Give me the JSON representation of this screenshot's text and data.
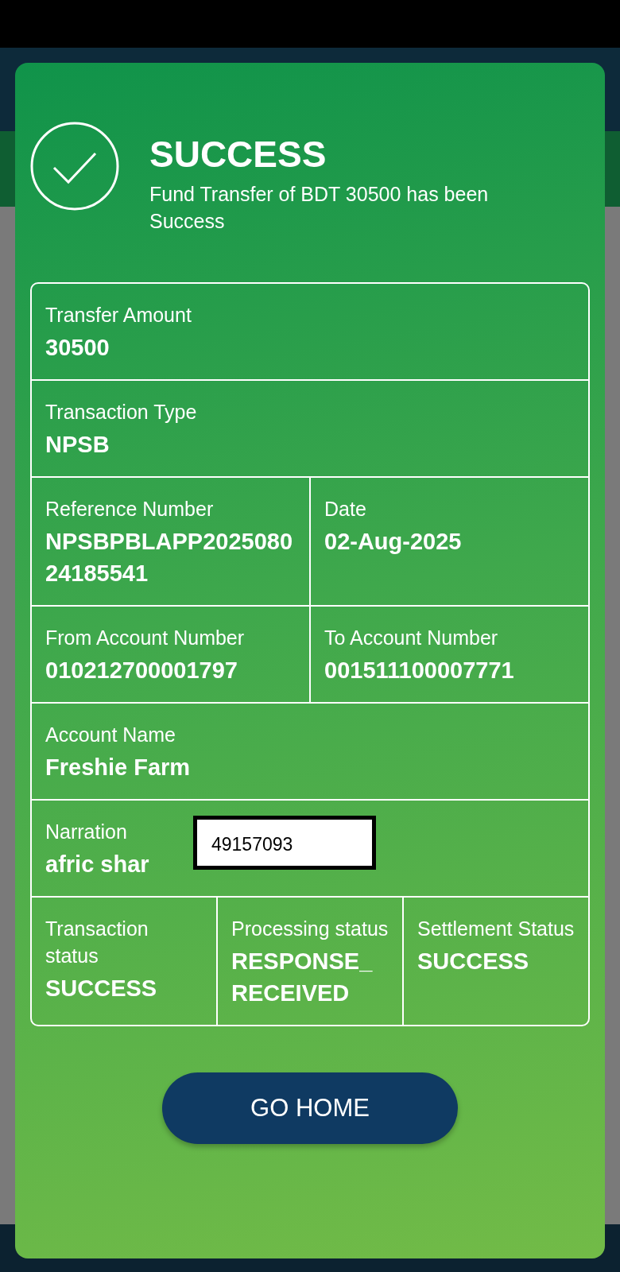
{
  "dialog": {
    "title": "SUCCESS",
    "message": "Fund Transfer of BDT 30500 has been Success"
  },
  "details": [
    {
      "cells": [
        {
          "label": "Transfer Amount",
          "value": "30500"
        }
      ]
    },
    {
      "cells": [
        {
          "label": "Transaction Type",
          "value": "NPSB"
        }
      ]
    },
    {
      "cells": [
        {
          "label": "Reference Number",
          "value": "NPSBPBLAPP202508024185541"
        },
        {
          "label": "Date",
          "value": "02-Aug-2025"
        }
      ]
    },
    {
      "cells": [
        {
          "label": "From Account Number",
          "value": "010212700001797"
        },
        {
          "label": "To Account Number",
          "value": "001511100007771"
        }
      ]
    },
    {
      "cells": [
        {
          "label": "Account Name",
          "value": "Freshie Farm"
        }
      ]
    },
    {
      "cells": [
        {
          "label": "Narration",
          "value": "afric shar"
        }
      ],
      "note": "49157093"
    },
    {
      "cells": [
        {
          "label": "Transaction status",
          "value": "SUCCESS"
        },
        {
          "label": "Processing status",
          "value": "RESPONSE_RECEIVED"
        },
        {
          "label": "Settlement Status",
          "value": "SUCCESS"
        }
      ]
    }
  ],
  "button": "GO HOME"
}
